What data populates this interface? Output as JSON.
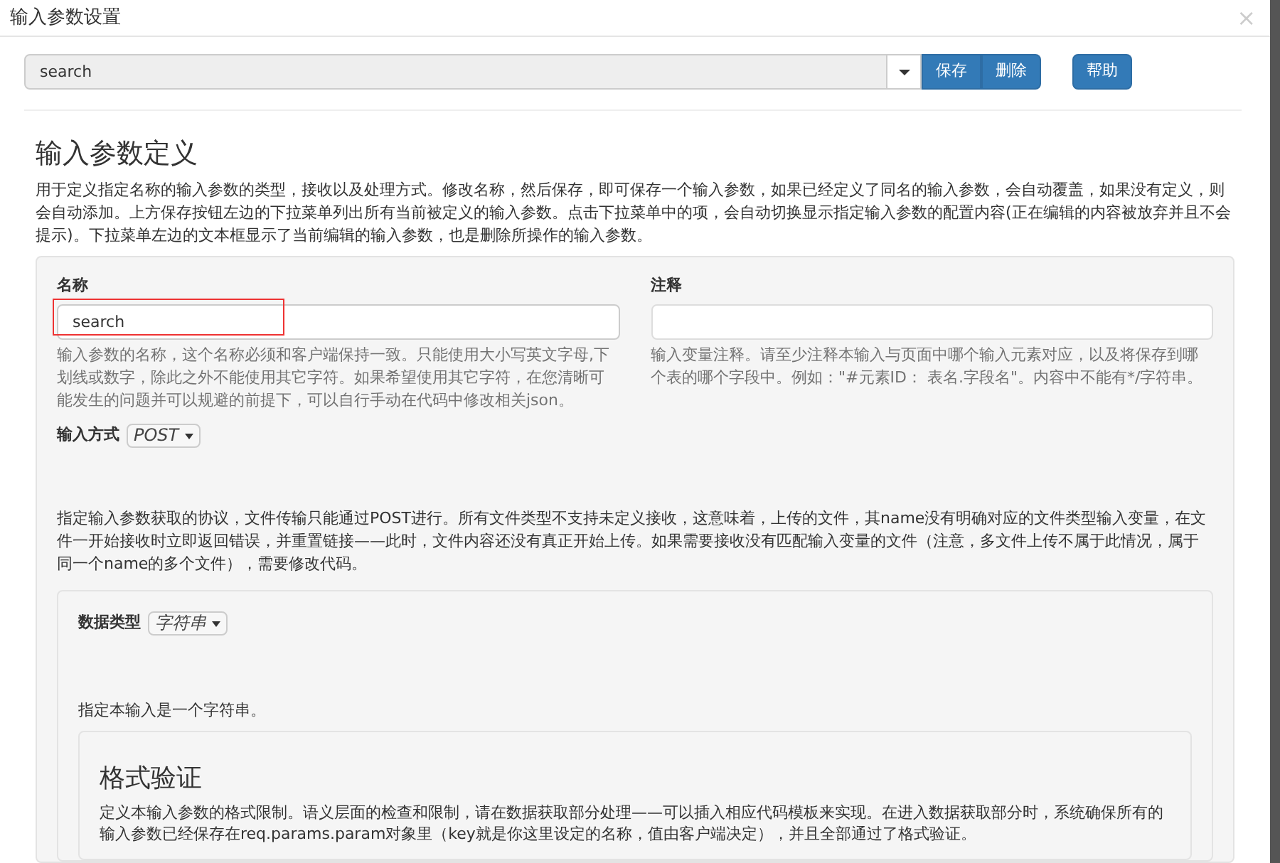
{
  "window": {
    "title": "输入参数设置",
    "close": "×"
  },
  "toolbar": {
    "param_value": "search",
    "buttons": [
      "保存",
      "删除"
    ],
    "help": "帮助"
  },
  "section": {
    "title": "输入参数定义",
    "description": "用于定义指定名称的输入参数的类型，接收以及处理方式。修改名称，然后保存，即可保存一个输入参数，如果已经定义了同名的输入参数，会自动覆盖，如果没有定义，则会自动添加。上方保存按钮左边的下拉菜单列出所有当前被定义的输入参数。点击下拉菜单中的项，会自动切换显示指定输入参数的配置内容(正在编辑的内容被放弃并且不会提示)。下拉菜单左边的文本框显示了当前编辑的输入参数，也是删除所操作的输入参数。"
  },
  "fields": [
    {
      "label": "名称",
      "value": "search",
      "highlighted": true,
      "help": "输入参数的名称，这个名称必须和客户端保持一致。只能使用大小写英文字母,下划线或数字，除此之外不能使用其它字符。如果希望使用其它字符，在您清晰可能发生的问题并可以规避的前提下，可以自行手动在代码中修改相关json。"
    },
    {
      "label": "注释",
      "highlighted": false,
      "help": "输入变量注释。请至少注释本输入与页面中哪个输入元素对应，以及将保存到哪个表的哪个字段中。例如：\"#元素ID： 表名.字段名\"。内容中不能有*/字符串。"
    }
  ],
  "input_method": {
    "label": "输入方式",
    "value": "POST",
    "description": "指定输入参数获取的协议，文件传输只能通过POST进行。所有文件类型不支持未定义接收，这意味着，上传的文件，其name没有明确对应的文件类型输入变量，在文件一开始接收时立即返回错误，并重置链接——此时，文件内容还没有真正开始上传。如果需要接收没有匹配输入变量的文件（注意，多文件上传不属于此情况，属于同一个name的多个文件），需要修改代码。"
  },
  "data_type": {
    "label": "数据类型",
    "value": "字符串",
    "description": "指定本输入是一个字符串。"
  },
  "validation": {
    "title": "格式验证",
    "description": "定义本输入参数的格式限制。语义层面的检查和限制，请在数据获取部分处理——可以插入相应代码模板来实现。在进入数据获取部分时，系统确保所有的输入参数已经保存在req.params.param对象里（key就是你这里设定的名称，值由客户端决定），并且全部通过了格式验证。"
  }
}
